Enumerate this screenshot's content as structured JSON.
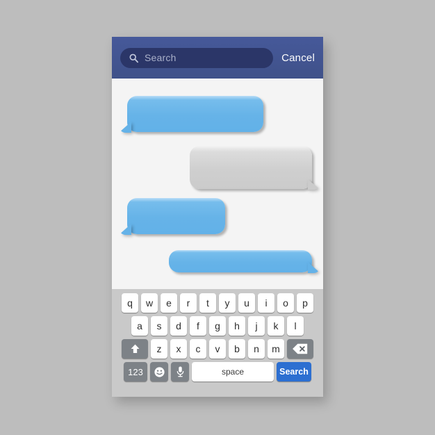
{
  "app": {
    "title": "Messaging app mockup",
    "outer_background": "#bdbdbd",
    "chat_background": "#f4f4f4"
  },
  "header": {
    "background_color": "#42548f",
    "search": {
      "icon": "search-icon",
      "placeholder": "Search",
      "value": "",
      "field_color": "#2b3668"
    },
    "cancel_label": "Cancel"
  },
  "chat": {
    "bubbles": [
      {
        "id": "bubble-1",
        "side": "left",
        "color": "#64b2e8",
        "style": "blue",
        "text": "",
        "tail": "bottom-left"
      },
      {
        "id": "bubble-2",
        "side": "right",
        "color": "#cbcbcb",
        "style": "gray",
        "text": "",
        "tail": "bottom-right"
      },
      {
        "id": "bubble-3",
        "side": "left",
        "color": "#64b2e8",
        "style": "blue",
        "text": "",
        "tail": "bottom-left"
      },
      {
        "id": "bubble-4",
        "side": "right",
        "color": "#64b2e8",
        "style": "blue",
        "text": "",
        "tail": "bottom-right"
      }
    ]
  },
  "keyboard": {
    "background_color": "#c9c9c9",
    "key_color": "#ffffff",
    "modifier_key_color": "#7d8287",
    "accent_color": "#2c6fd1",
    "row1": [
      "q",
      "w",
      "e",
      "r",
      "t",
      "y",
      "u",
      "i",
      "o",
      "p"
    ],
    "row2": [
      "a",
      "s",
      "d",
      "f",
      "g",
      "h",
      "j",
      "k",
      "l"
    ],
    "row3": [
      "z",
      "x",
      "c",
      "v",
      "b",
      "n",
      "m"
    ],
    "shift_key": {
      "icon": "shift-arrow-icon",
      "label": ""
    },
    "backspace_key": {
      "icon": "backspace-icon",
      "label": ""
    },
    "numbers_key": {
      "label": "123"
    },
    "emoji_key": {
      "icon": "smiley-icon",
      "label": ""
    },
    "mic_key": {
      "icon": "microphone-icon",
      "label": ""
    },
    "space_key": {
      "label": "space"
    },
    "search_key": {
      "label": "Search"
    }
  }
}
